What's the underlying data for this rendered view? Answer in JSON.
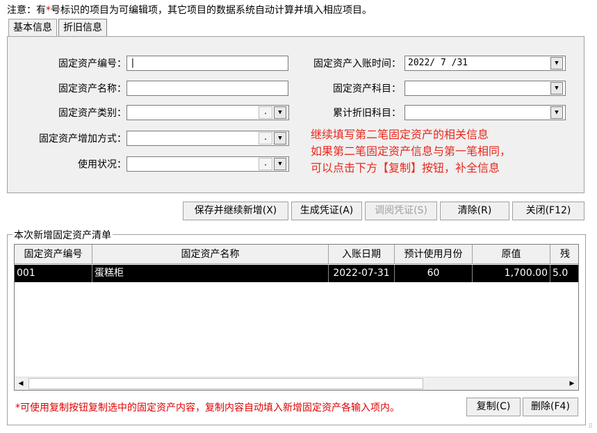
{
  "notice": {
    "prefix": "注意：有",
    "star": "*",
    "suffix": "号标识的项目为可编辑项，其它项目的数据系统自动计算并填入相应项目。"
  },
  "tabs": [
    {
      "label": "基本信息"
    },
    {
      "label": "折旧信息"
    }
  ],
  "form": {
    "asset_code": {
      "label": "固定资产编号：",
      "value": ""
    },
    "asset_name": {
      "label": "固定资产名称：",
      "value": ""
    },
    "asset_category": {
      "label": "固定资产类别：",
      "value": ""
    },
    "add_method": {
      "label": "固定资产增加方式：",
      "value": ""
    },
    "usage_status": {
      "label": "使用状况：",
      "value": ""
    },
    "entry_date": {
      "label": "固定资产入账时间：",
      "value": "2022/ 7 /31"
    },
    "asset_subject": {
      "label": "固定资产科目：",
      "value": ""
    },
    "depr_subject": {
      "label": "累计折旧科目：",
      "value": ""
    },
    "dots": ". "
  },
  "hint_lines": [
    "继续填写第二笔固定资产的相关信息",
    "如果第二笔固定资产信息与第一笔相同，",
    "可以点击下方【复制】按钮，补全信息"
  ],
  "actions": {
    "save_continue": "保存并继续新增(X)",
    "gen_voucher": "生成凭证(A)",
    "view_voucher": "调阅凭证(S)",
    "clear": "清除(R)",
    "close": "关闭(F12)"
  },
  "list": {
    "title": "本次新增固定资产清单",
    "columns": [
      "固定资产编号",
      "固定资产名称",
      "入账日期",
      "预计使用月份",
      "原值",
      "残"
    ],
    "rows": [
      {
        "code": "001",
        "name": "蛋糕柜",
        "date": "2022-07-31",
        "months": "60",
        "value": "1,700.00",
        "residual": "5.0"
      }
    ]
  },
  "footnote": "*可使用复制按钮复制选中的固定资产内容，复制内容自动填入新增固定资产各输入项内。",
  "bottom_buttons": {
    "copy": "复制(C)",
    "delete": "删除(F4)"
  },
  "icons": {
    "dropdown": "▼",
    "left": "◀",
    "right": "▶",
    "grip": "⠿"
  },
  "colors": {
    "notice_star": "#e00000",
    "hint": "#e8281c",
    "selected_row": "#000000"
  }
}
